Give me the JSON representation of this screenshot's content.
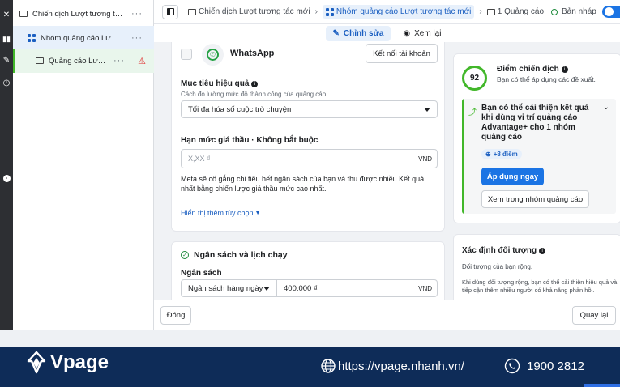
{
  "tree": {
    "campaign_label": "Chiến dịch Lượt tương tác ...",
    "adset_label": "Nhóm quảng cáo Lượt t...",
    "ad_label": "Quảng cáo Lượt...",
    "more": "···"
  },
  "breadcrumb": {
    "campaign": "Chiến dịch Lượt tương tác mới",
    "adset": "Nhóm quảng cáo Lượt tương tác mới",
    "ad": "1 Quảng cáo",
    "status": "Bản nháp"
  },
  "tabs": {
    "edit": "Chỉnh sửa",
    "preview": "Xem lại"
  },
  "whatsapp": {
    "name": "WhatsApp",
    "connect_button": "Kết nối tài khoản"
  },
  "goal": {
    "title": "Mục tiêu hiệu quả",
    "description": "Cách đo lường mức độ thành công của quảng cáo.",
    "selected": "Tối đa hóa số cuộc trò chuyện"
  },
  "bid": {
    "title": "Hạn mức giá thầu · Không bắt buộc",
    "placeholder": "X,XX ₫",
    "currency": "VND",
    "note": "Meta sẽ cố gắng chi tiêu hết ngân sách của bạn và thu được nhiều Kết quả nhất bằng chiến lược giá thầu mức cao nhất.",
    "more_options": "Hiển thị thêm tùy chọn"
  },
  "budget": {
    "section_title": "Ngân sách và lịch chạy",
    "label": "Ngân sách",
    "type": "Ngân sách hàng ngày",
    "amount": "400.000 ₫",
    "currency": "VND"
  },
  "score": {
    "value": "92",
    "title": "Điểm chiến dịch",
    "subtitle": "Bạn có thể áp dụng các đề xuất."
  },
  "recommendation": {
    "text": "Bạn có thể cải thiện kết quả khi dùng vị trí quảng cáo Advantage+ cho 1 nhóm quảng cáo",
    "badge": "+8 điểm",
    "apply_button": "Áp dụng ngay",
    "view_button": "Xem trong nhóm quảng cáo"
  },
  "audience": {
    "title": "Xác định đối tượng",
    "summary": "Đối tượng của bạn rộng.",
    "detail": "Khi dùng đối tượng rộng, bạn có thể cải thiện hiệu quả và tiếp cận thêm nhiều người có khả năng phản hồi."
  },
  "footer": {
    "close_button": "Đóng",
    "back_button": "Quay lại"
  },
  "banner": {
    "brand": "Vpage",
    "url": "https://vpage.nhanh.vn/",
    "phone": "1900 2812"
  },
  "colors": {
    "accent": "#1b74e4",
    "banner_bg": "#0e2c58",
    "score_ring": "#42b72a"
  }
}
